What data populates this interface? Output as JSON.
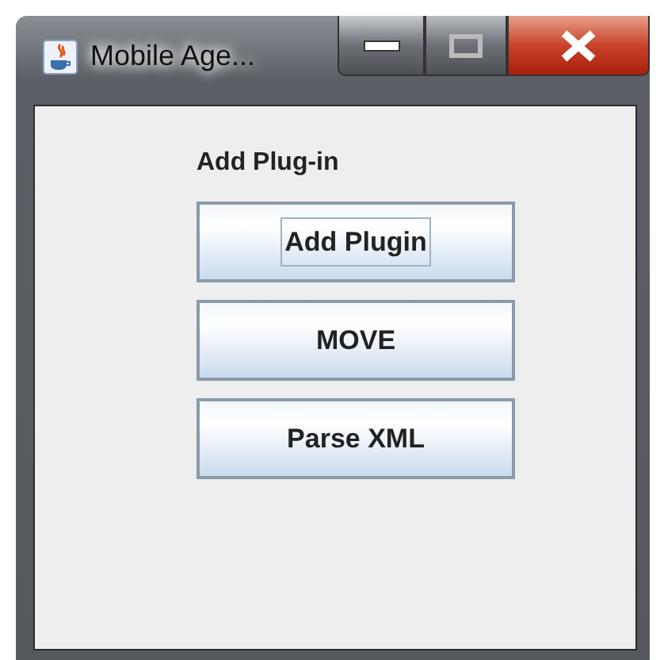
{
  "window": {
    "title": "Mobile Age..."
  },
  "heading": "Add Plug-in",
  "buttons": [
    {
      "label": "Add Plugin",
      "focused": true
    },
    {
      "label": "MOVE",
      "focused": false
    },
    {
      "label": "Parse XML",
      "focused": false
    }
  ]
}
